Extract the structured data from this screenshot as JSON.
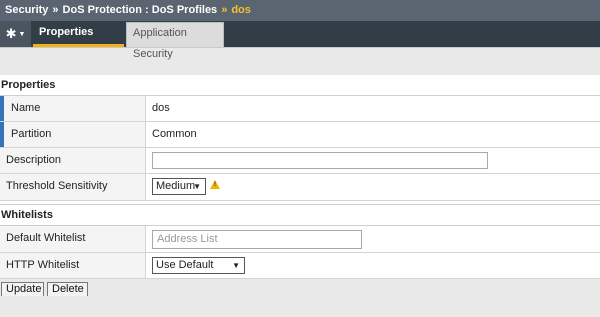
{
  "breadcrumb": {
    "items": [
      "Security",
      "DoS Protection : DoS Profiles"
    ],
    "current": "dos",
    "separator": "»"
  },
  "tabs": [
    {
      "label": "Properties",
      "active": true
    },
    {
      "label": "Application Security",
      "active": false
    }
  ],
  "sections": {
    "properties": {
      "title": "Properties",
      "name_label": "Name",
      "name_value": "dos",
      "partition_label": "Partition",
      "partition_value": "Common",
      "description_label": "Description",
      "description_value": "",
      "threshold_label": "Threshold Sensitivity",
      "threshold_value": "Medium"
    },
    "whitelists": {
      "title": "Whitelists",
      "default_label": "Default Whitelist",
      "default_placeholder": "Address List",
      "http_label": "HTTP Whitelist",
      "http_value": "Use Default"
    }
  },
  "actions": {
    "update_label": "Update",
    "delete_label": "Delete"
  },
  "icons": {
    "gear": "gear-icon",
    "warning": "warning-icon"
  },
  "colors": {
    "accent": "#f2b21b",
    "breadcrumb_bg": "#5b6571",
    "tabbar_bg": "#333d47",
    "required_marker": "#3572b8"
  }
}
